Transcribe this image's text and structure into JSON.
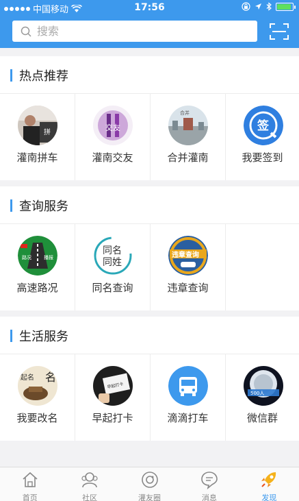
{
  "status_bar": {
    "carrier": "中国移动",
    "time": "17:56",
    "battery_color": "#5fe05f"
  },
  "header": {
    "search_placeholder": "搜索",
    "scan_icon": "scan-icon",
    "accent_color": "#3d99ed"
  },
  "sections": [
    {
      "title": "热点推荐",
      "items": [
        {
          "label": "灌南拼车",
          "icon": "carpool-photo"
        },
        {
          "label": "灌南交友",
          "icon": "dating-photo"
        },
        {
          "label": "合并灌南",
          "icon": "city-photo"
        },
        {
          "label": "我要签到",
          "icon": "sign-in-icon"
        }
      ]
    },
    {
      "title": "查询服务",
      "items": [
        {
          "label": "高速路况",
          "icon": "highway-icon"
        },
        {
          "label": "同名查询",
          "icon": "same-name-icon"
        },
        {
          "label": "违章查询",
          "icon": "violation-icon"
        }
      ],
      "icon_texts": {
        "highway_left": "路况",
        "highway_right": "播报",
        "same_name_line1": "同名",
        "same_name_line2": "同姓",
        "violation": "违章查询"
      }
    },
    {
      "title": "生活服务",
      "items": [
        {
          "label": "我要改名",
          "icon": "rename-photo"
        },
        {
          "label": "早起打卡",
          "icon": "early-rise-photo"
        },
        {
          "label": "滴滴打车",
          "icon": "bus-icon"
        },
        {
          "label": "微信群",
          "icon": "wechat-group-photo"
        }
      ]
    }
  ],
  "tab_bar": {
    "tabs": [
      {
        "label": "首页",
        "icon": "home-icon",
        "active": false
      },
      {
        "label": "社区",
        "icon": "community-icon",
        "active": false
      },
      {
        "label": "灌友圈",
        "icon": "circle-icon",
        "active": false
      },
      {
        "label": "消息",
        "icon": "message-icon",
        "active": false
      },
      {
        "label": "发现",
        "icon": "rocket-icon",
        "active": true
      }
    ]
  }
}
